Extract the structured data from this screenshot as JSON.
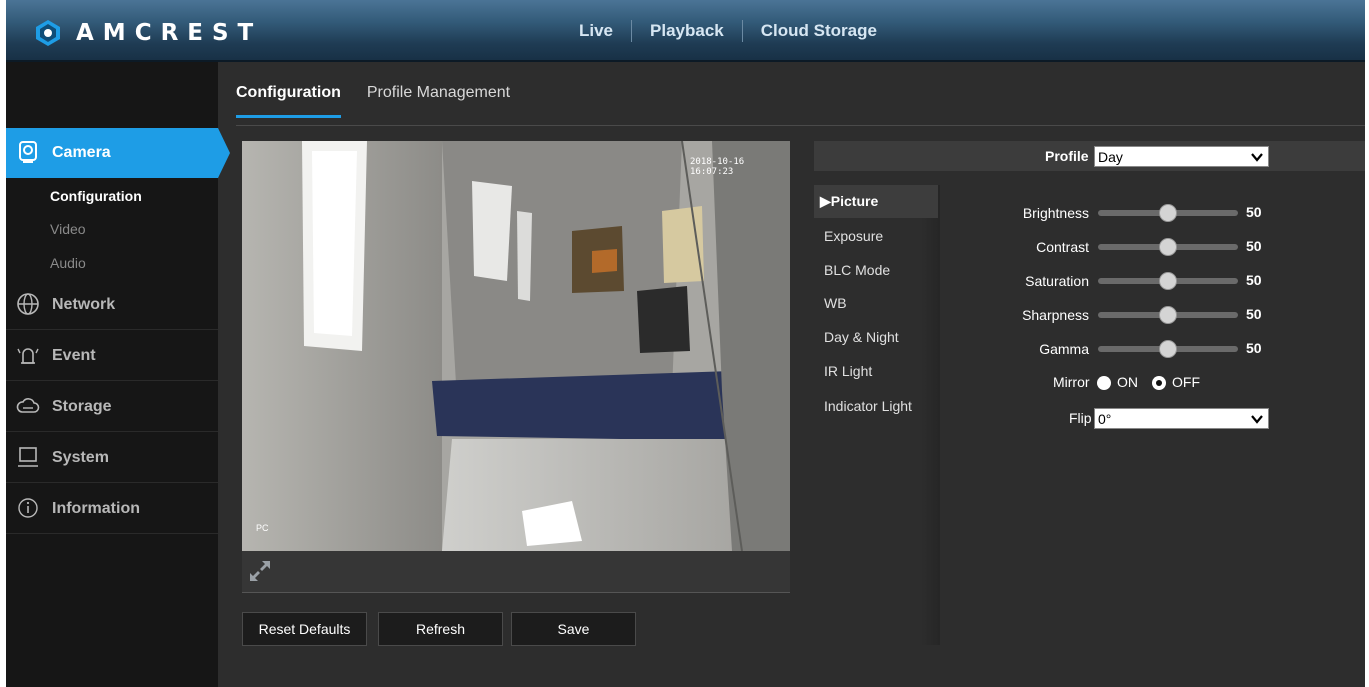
{
  "brand": "AMCREST",
  "topnav": [
    "Live",
    "Playback",
    "Cloud Storage"
  ],
  "sidebar": {
    "categories": [
      {
        "label": "Camera",
        "icon": "camera-icon"
      },
      {
        "label": "Network",
        "icon": "globe-icon"
      },
      {
        "label": "Event",
        "icon": "alarm-icon"
      },
      {
        "label": "Storage",
        "icon": "cloud-icon"
      },
      {
        "label": "System",
        "icon": "monitor-icon"
      },
      {
        "label": "Information",
        "icon": "info-icon"
      }
    ],
    "camera_sub": [
      "Configuration",
      "Video",
      "Audio"
    ]
  },
  "tabs": [
    "Configuration",
    "Profile Management"
  ],
  "video": {
    "timestamp": "2018-10-16 16:07:23",
    "osd_label": "PC"
  },
  "buttons": {
    "reset": "Reset Defaults",
    "refresh": "Refresh",
    "save": "Save"
  },
  "profile": {
    "label": "Profile",
    "value": "Day"
  },
  "menu": [
    "▶Picture",
    "Exposure",
    "BLC Mode",
    "WB",
    "Day & Night",
    "IR Light",
    "Indicator Light"
  ],
  "sliders": [
    {
      "label": "Brightness",
      "value": 50
    },
    {
      "label": "Contrast",
      "value": 50
    },
    {
      "label": "Saturation",
      "value": 50
    },
    {
      "label": "Sharpness",
      "value": 50
    },
    {
      "label": "Gamma",
      "value": 50
    }
  ],
  "mirror": {
    "label": "Mirror",
    "on": "ON",
    "off": "OFF",
    "selected": "OFF"
  },
  "flip": {
    "label": "Flip",
    "value": "0°"
  },
  "colors": {
    "accent": "#1e9de6",
    "sidebar": "#161616",
    "panel": "#2d2d2d"
  }
}
